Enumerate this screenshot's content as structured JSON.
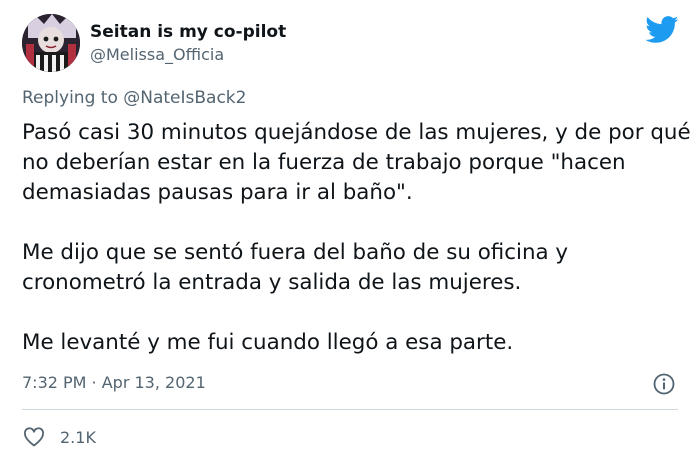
{
  "author": {
    "display_name": "Seitan is my co-pilot",
    "handle": "@Melissa_Officia"
  },
  "reply": {
    "prefix": "Replying to ",
    "mention": "@NateIsBack2"
  },
  "tweet": {
    "paragraphs": [
      "Pasó casi 30 minutos quejándose de las mujeres, y de por qué no deberían estar en la fuerza de trabajo porque \"hacen demasiadas pausas para ir al baño\".",
      "Me dijo que se sentó fuera del baño de su oficina y cronometró la entrada y salida de las mujeres.",
      "Me levanté y me fui cuando llegó a esa parte."
    ],
    "timestamp": "7:32 PM · Apr 13, 2021"
  },
  "engagement": {
    "likes": "2.1K"
  },
  "icons": {
    "brand": "twitter-bird-icon",
    "info": "info-icon",
    "like": "heart-icon"
  },
  "colors": {
    "brand_blue": "#1d9bf0",
    "text_primary": "#0f1419",
    "text_secondary": "#536471",
    "divider": "#cfd9de"
  }
}
